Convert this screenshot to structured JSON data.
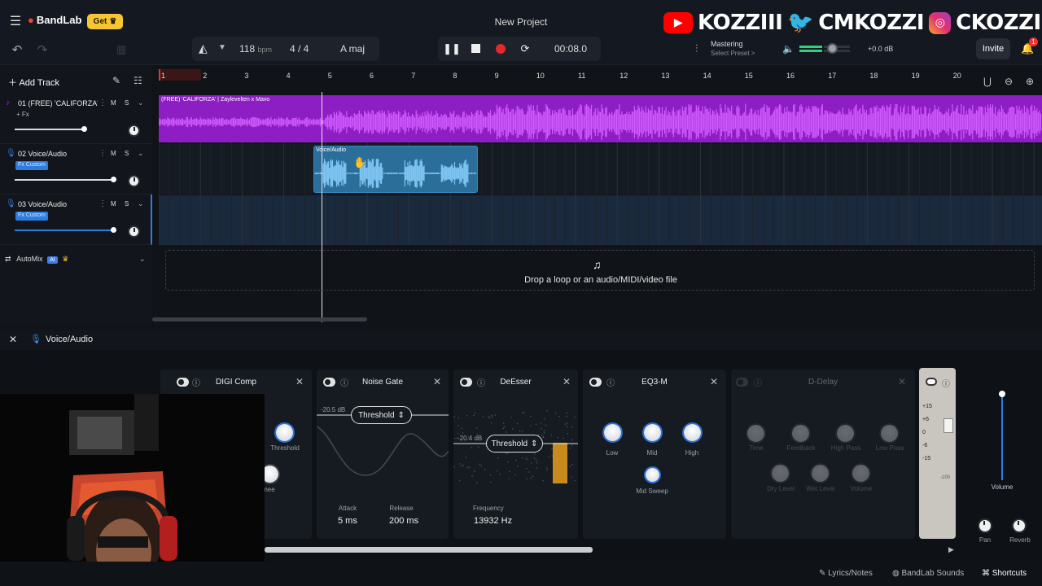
{
  "app": {
    "logo": "BandLab",
    "get_label": "Get",
    "project_title": "New Project"
  },
  "toolbar": {
    "tempo_value": "118",
    "tempo_unit": "bpm",
    "time_signature": "4 / 4",
    "key": "A maj",
    "time_display": "00:08.0",
    "mastering_label": "Mastering",
    "mastering_preset": "Select Preset >",
    "master_gain": "+0.0 dB",
    "master_level": 0.45,
    "invite_label": "Invite",
    "notification_count": "1"
  },
  "social": {
    "youtube": "KOZZIII",
    "twitter": "CMKOZZI",
    "instagram": "CKOZZI"
  },
  "track_panel": {
    "add_track_label": "Add Track",
    "tracks": [
      {
        "name": "01  (FREE) 'CALIFORZA' ...",
        "m": "M",
        "s": "S",
        "fx": "+ Fx",
        "volume": 0.7,
        "color": "#a020f0"
      },
      {
        "name": "02  Voice/Audio",
        "m": "M",
        "s": "S",
        "fx": "Fx Custom",
        "volume": 0.98,
        "color": "#2d7de0"
      },
      {
        "name": "03  Voice/Audio",
        "m": "M",
        "s": "S",
        "fx": "Fx Custom",
        "volume": 0.98,
        "color": "#2d7de0"
      }
    ],
    "automix_label": "AutoMix",
    "automix_ai": "AI"
  },
  "timeline": {
    "bars": [
      "1",
      "2",
      "3",
      "4",
      "5",
      "6",
      "7",
      "8",
      "9",
      "10",
      "11",
      "12",
      "13",
      "14",
      "15",
      "16",
      "17",
      "18",
      "19",
      "20"
    ],
    "region1_label": "(FREE) 'CALIFORZA'  |  Zaylevelten x Mavo",
    "clip_label": "Voice/Audio",
    "drop_text": "Drop a loop or an audio/MIDI/video file"
  },
  "fx_panel": {
    "track_name": "Voice/Audio",
    "plugins": {
      "comp": {
        "name": "DIGI Comp",
        "threshold_label": "Threshold",
        "knee_label": "nee"
      },
      "gate": {
        "name": "Noise Gate",
        "db": "-20.5 dB",
        "threshold_label": "Threshold",
        "attack_label": "Attack",
        "attack_value": "5 ms",
        "release_label": "Release",
        "release_value": "200 ms"
      },
      "deesser": {
        "name": "DeEsser",
        "db": "-20.4 dB",
        "threshold_label": "Threshold",
        "frequency_label": "Frequency",
        "frequency_value": "13932 Hz"
      },
      "eq": {
        "name": "EQ3-M",
        "low": "Low",
        "mid": "Mid",
        "high": "High",
        "mid_sweep": "Mid Sweep"
      },
      "delay": {
        "name": "D-Delay",
        "time": "Time",
        "feedback": "Feedback",
        "high_pass": "High Pass",
        "low_pass": "Low Pass",
        "dry": "Dry Level",
        "wet": "Wet Level",
        "volume": "Volume"
      }
    },
    "mixer": {
      "scale": [
        "+15",
        "+6",
        "0",
        "-6",
        "-15"
      ],
      "bottom_value": "-100",
      "volume_label": "Volume",
      "pan_label": "Pan",
      "reverb_label": "Reverb"
    }
  },
  "footer": {
    "lyrics": "Lyrics/Notes",
    "sounds": "BandLab Sounds",
    "shortcuts": "Shortcuts"
  }
}
